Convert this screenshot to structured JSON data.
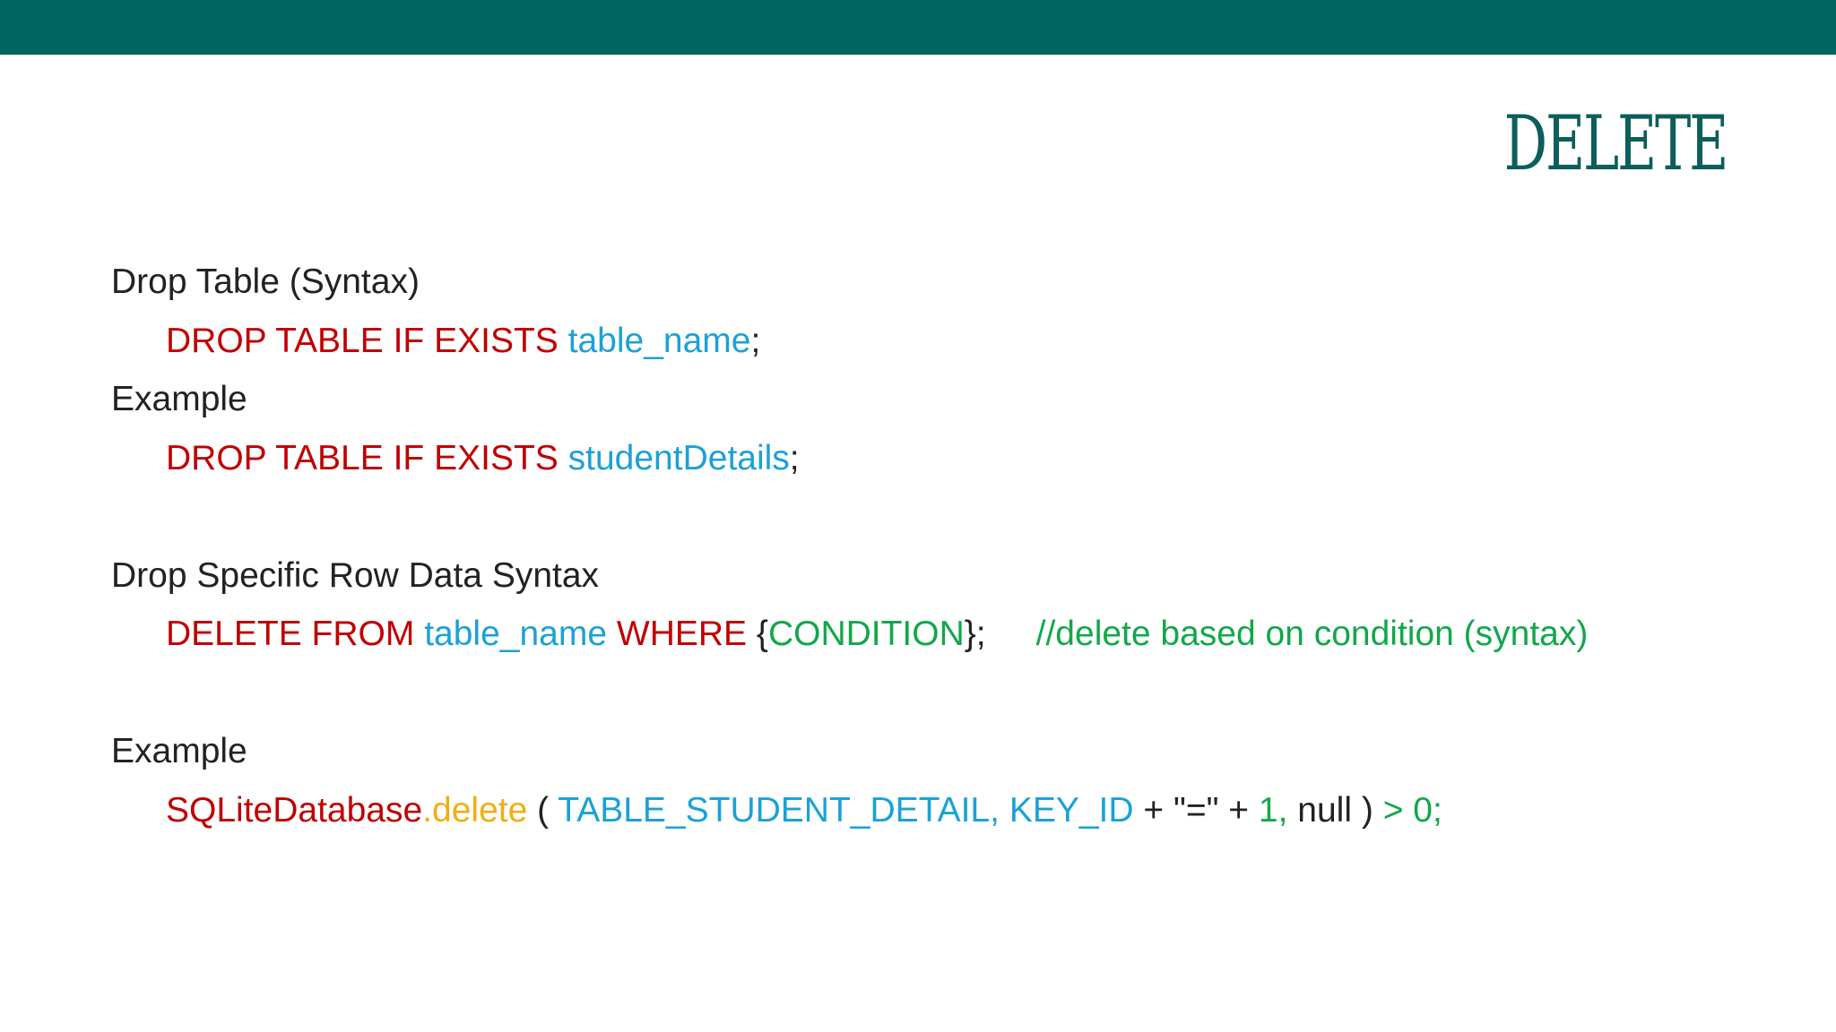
{
  "title": "DELETE",
  "colors": {
    "bar": "#006461",
    "title": "#0b5e5b",
    "keyword": "#c00000",
    "identifier": "#1ba1d6",
    "literal": "#11a84a",
    "method": "#f2ae10",
    "text": "#222222"
  },
  "section1": {
    "heading": "Drop Table (Syntax)",
    "code": {
      "keyword": "DROP TABLE IF EXISTS",
      "identifier": "table_name",
      "terminator": ";"
    },
    "example_label": "Example",
    "example_code": {
      "keyword": "DROP TABLE IF EXISTS",
      "identifier": "studentDetails",
      "terminator": ";"
    }
  },
  "section2": {
    "heading": "Drop Specific Row Data Syntax",
    "code": {
      "kw_delete": "DELETE FROM",
      "table": "table_name",
      "kw_where": "WHERE",
      "brace_open": "{",
      "condition": "CONDITION",
      "brace_close": "};",
      "comment": "//delete based on condition (syntax)"
    }
  },
  "section3": {
    "example_label": "Example",
    "code": {
      "object": "SQLiteDatabase",
      "dot": ".",
      "method": "delete",
      "paren_open": "(",
      "arg1": "TABLE_STUDENT_DETAIL,",
      "arg2": "KEY_ID",
      "concat": "+ \"=\" +",
      "number": "1,",
      "null_close": "null )",
      "compare": "> 0;"
    }
  }
}
